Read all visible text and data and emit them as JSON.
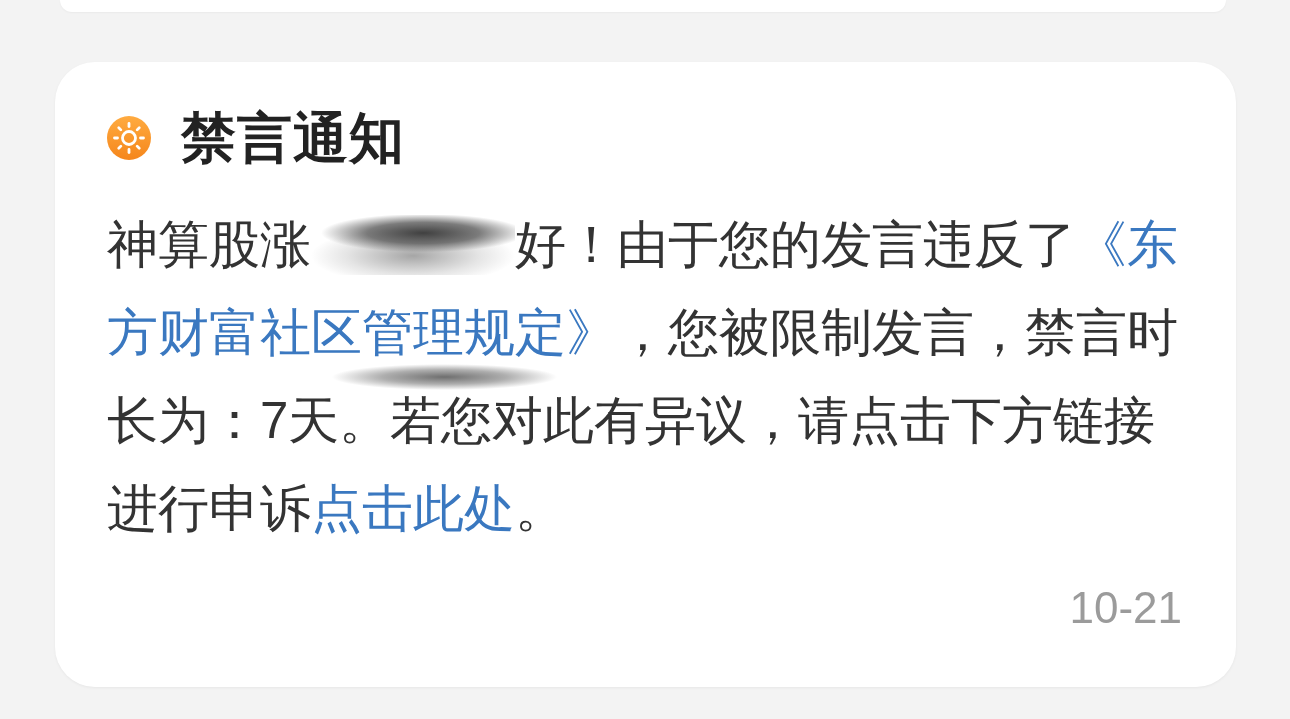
{
  "notice": {
    "title": "禁言通知",
    "message_lines": [
      [
        {
          "kind": "text",
          "text": "神算股涨"
        },
        {
          "kind": "redacted"
        },
        {
          "kind": "text",
          "text": "好！由于您的发言违反了"
        },
        {
          "kind": "link",
          "text": "《东"
        }
      ],
      [
        {
          "kind": "link",
          "text": "方财富社区管理规定》"
        },
        {
          "kind": "text",
          "text": "，您被限制发言，禁言时"
        }
      ],
      [
        {
          "kind": "text",
          "text": "长为：7天。若您对此有异议，请点击下方链接"
        }
      ],
      [
        {
          "kind": "text",
          "text": "进行申诉"
        },
        {
          "kind": "link",
          "text": "点击此处"
        },
        {
          "kind": "text",
          "text": "。"
        }
      ]
    ],
    "date": "10-21"
  }
}
